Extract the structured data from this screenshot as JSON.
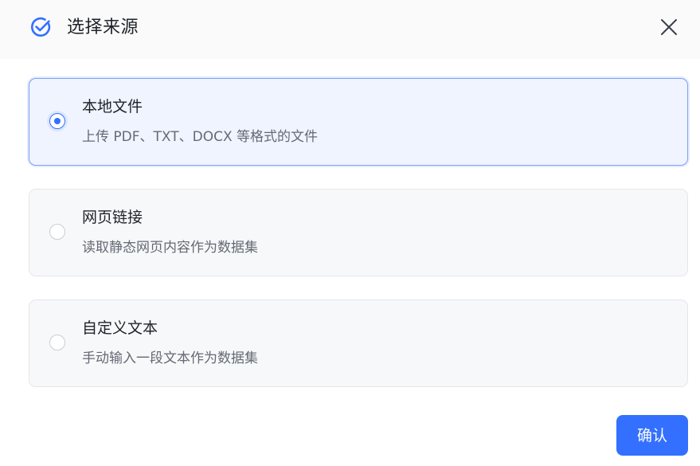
{
  "dialog": {
    "title": "选择来源",
    "title_icon": "check-circle-icon",
    "close_icon": "close-icon"
  },
  "options": [
    {
      "title": "本地文件",
      "description": "上传 PDF、TXT、DOCX 等格式的文件",
      "selected": true
    },
    {
      "title": "网页链接",
      "description": "读取静态网页内容作为数据集",
      "selected": false
    },
    {
      "title": "自定义文本",
      "description": "手动输入一段文本作为数据集",
      "selected": false
    }
  ],
  "footer": {
    "confirm_label": "确认"
  },
  "colors": {
    "accent": "#3370ff",
    "selected_bg": "#f0f4ff",
    "option_bg": "#f7f8fa",
    "header_bg": "#fafafa"
  }
}
